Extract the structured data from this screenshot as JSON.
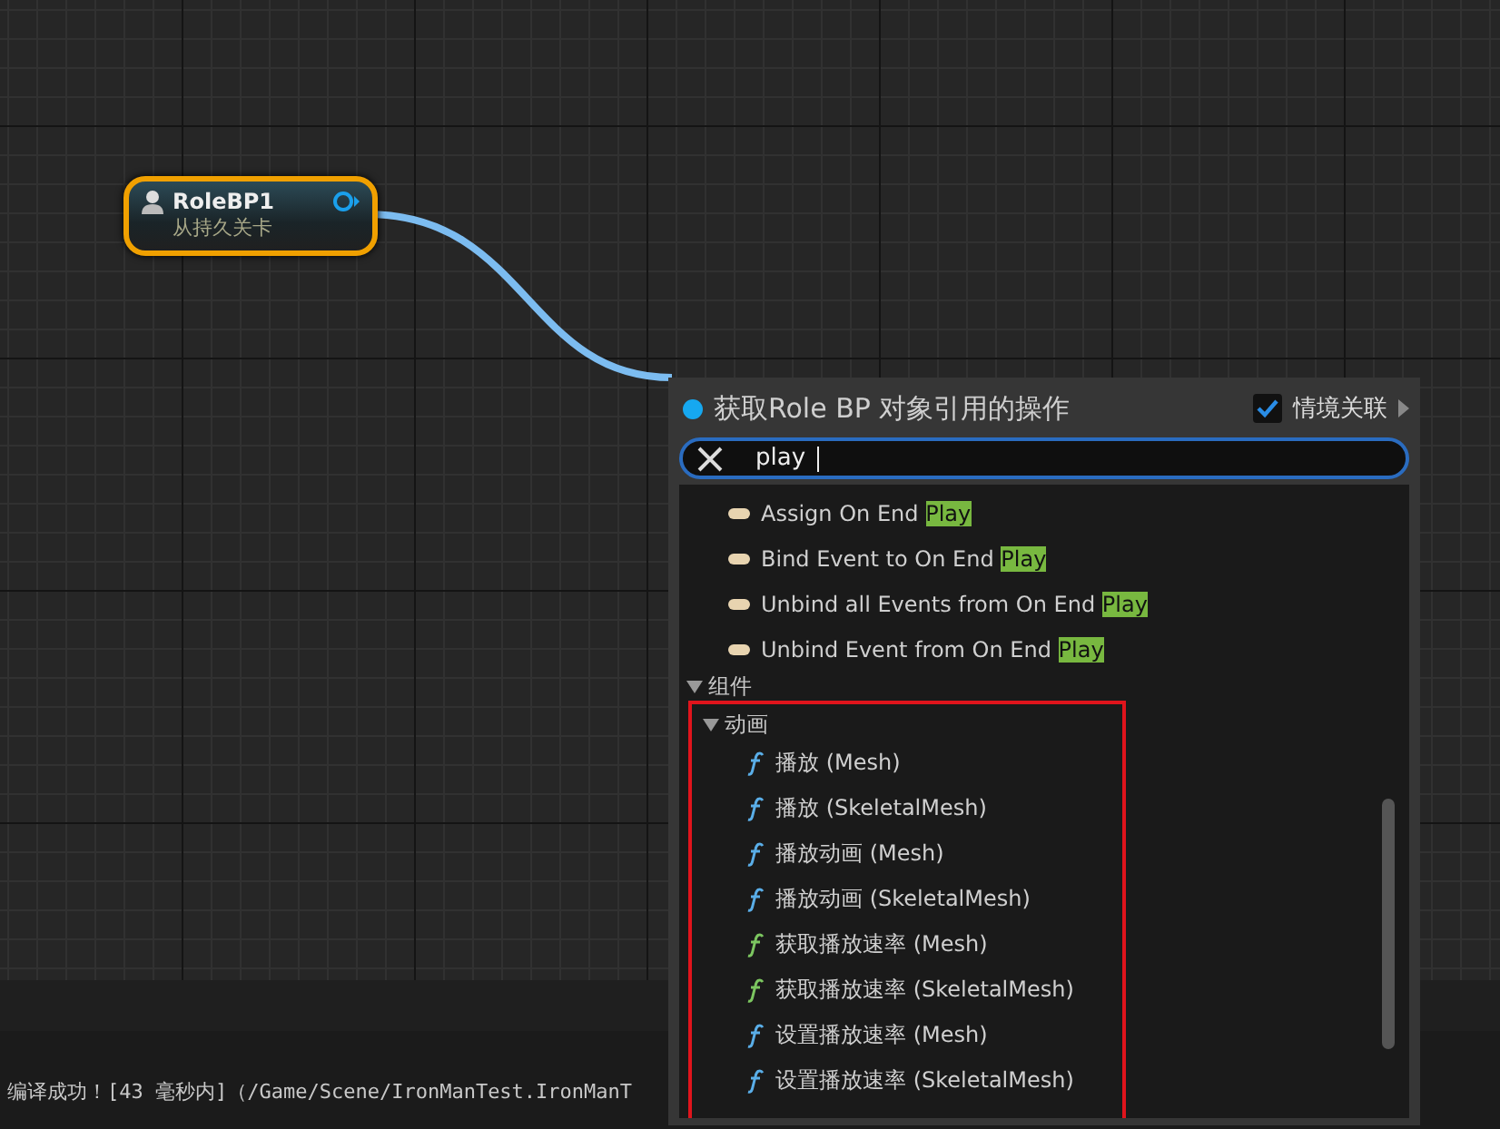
{
  "node": {
    "title": "RoleBP1",
    "subtitle": "从持久关卡"
  },
  "menu": {
    "title": "获取Role BP 对象引用的操作",
    "context_sensitive": {
      "label": "情境关联",
      "checked": true
    },
    "search": {
      "value": "play"
    },
    "event_items": [
      {
        "label": "Assign On End ",
        "highlight": "Play"
      },
      {
        "label": "Bind Event to On End ",
        "highlight": "Play"
      },
      {
        "label": "Unbind all Events from On End ",
        "highlight": "Play"
      },
      {
        "label": "Unbind Event from On End ",
        "highlight": "Play"
      }
    ],
    "categories": [
      {
        "label": "组件",
        "expanded": true,
        "children": [
          {
            "label": "动画",
            "expanded": true,
            "children": [
              {
                "label": "播放 (Mesh)",
                "color": "#5aaee8"
              },
              {
                "label": "播放 (SkeletalMesh)",
                "color": "#5aaee8"
              },
              {
                "label": "播放动画 (Mesh)",
                "color": "#5aaee8"
              },
              {
                "label": "播放动画 (SkeletalMesh)",
                "color": "#5aaee8"
              },
              {
                "label": "获取播放速率 (Mesh)",
                "color": "#7cc660"
              },
              {
                "label": "获取播放速率 (SkeletalMesh)",
                "color": "#7cc660"
              },
              {
                "label": "设置播放速率 (Mesh)",
                "color": "#5aaee8"
              },
              {
                "label": "设置播放速率 (SkeletalMesh)",
                "color": "#5aaee8"
              }
            ]
          }
        ]
      }
    ]
  },
  "status_bar": {
    "message": "编译成功！[43 毫秒内]（/Game/Scene/IronManTest.IronManT"
  }
}
